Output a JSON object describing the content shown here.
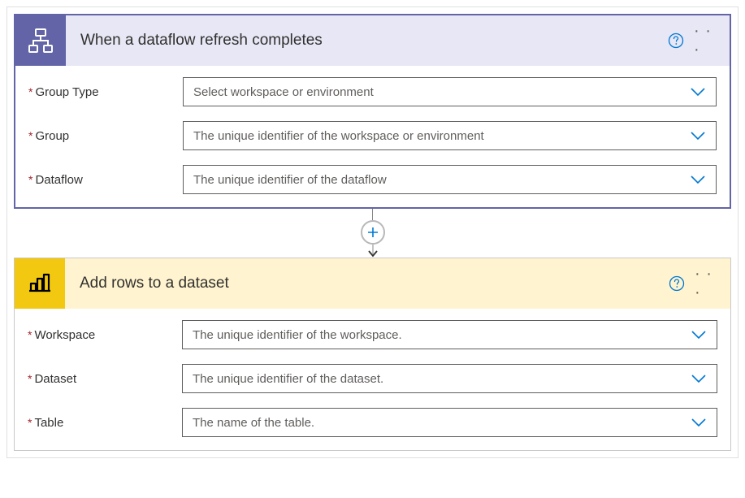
{
  "cards": [
    {
      "title": "When a dataflow refresh completes",
      "iconType": "dataflow",
      "selected": true,
      "fields": [
        {
          "label": "Group Type",
          "placeholder": "Select workspace or environment"
        },
        {
          "label": "Group",
          "placeholder": "The unique identifier of the workspace or environment"
        },
        {
          "label": "Dataflow",
          "placeholder": "The unique identifier of the dataflow"
        }
      ]
    },
    {
      "title": "Add rows to a dataset",
      "iconType": "dataset",
      "selected": false,
      "fields": [
        {
          "label": "Workspace",
          "placeholder": "The unique identifier of the workspace."
        },
        {
          "label": "Dataset",
          "placeholder": "The unique identifier of the dataset."
        },
        {
          "label": "Table",
          "placeholder": "The name of the table."
        }
      ]
    }
  ],
  "requiredMark": "*"
}
